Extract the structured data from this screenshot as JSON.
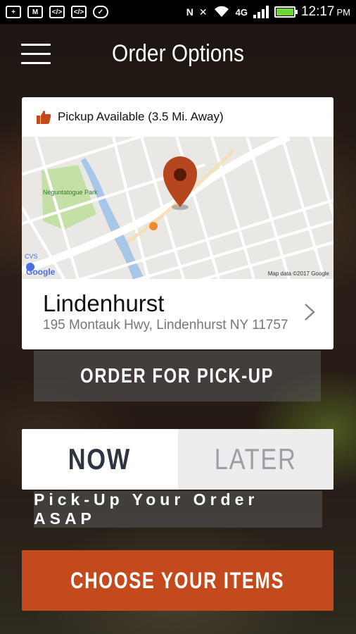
{
  "status_bar": {
    "time": "12:17",
    "ampm": "PM",
    "network": "4G"
  },
  "header": {
    "title": "Order Options"
  },
  "location_card": {
    "pickup_status": "Pickup Available (3.5 Mi. Away)",
    "map": {
      "park": "Neguntatogue Park",
      "attribution": "Map data ©2017 Google",
      "google": "Google",
      "cvs": "CVS"
    },
    "name": "Lindenhurst",
    "address": "195 Montauk Hwy, Lindenhurst NY 11757"
  },
  "order_pickup_label": "ORDER FOR PICK-UP",
  "time_toggle": {
    "now": "NOW",
    "later": "LATER",
    "selected": "now"
  },
  "asap_text": "Pick-Up Your Order ASAP",
  "choose_items_label": "CHOOSE YOUR ITEMS",
  "colors": {
    "accent": "#c44a1e",
    "pin": "#b5461d"
  }
}
